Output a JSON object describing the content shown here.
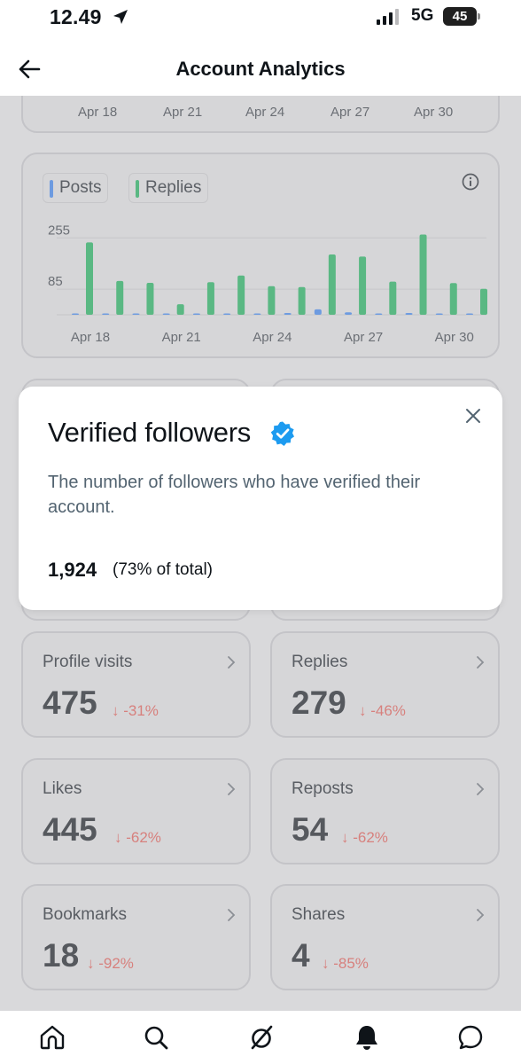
{
  "status": {
    "time": "12.49",
    "network": "5G",
    "battery": "45"
  },
  "header": {
    "title": "Account Analytics"
  },
  "top_card": {
    "dates": [
      "Apr 18",
      "Apr 21",
      "Apr 24",
      "Apr 27",
      "Apr 30"
    ]
  },
  "chart_data": {
    "type": "bar",
    "legend": [
      "Posts",
      "Replies"
    ],
    "y_ticks": [
      "255",
      "85"
    ],
    "x_ticks": [
      "Apr 18",
      "Apr 21",
      "Apr 24",
      "Apr 27",
      "Apr 30"
    ],
    "ylim": [
      0,
      300
    ],
    "categories": [
      "Apr 18",
      "Apr 19",
      "Apr 20",
      "Apr 21",
      "Apr 22",
      "Apr 23",
      "Apr 24",
      "Apr 25",
      "Apr 26",
      "Apr 27",
      "Apr 28",
      "Apr 29",
      "Apr 30",
      "May 1"
    ],
    "series": [
      {
        "name": "Posts",
        "color": "#6d9be0",
        "values": [
          1,
          1,
          0,
          1,
          1,
          0,
          0,
          6,
          18,
          8,
          1,
          6,
          1,
          1
        ]
      },
      {
        "name": "Replies",
        "color": "#5ab883",
        "values": [
          240,
          112,
          106,
          35,
          108,
          130,
          95,
          92,
          200,
          193,
          110,
          266,
          105,
          86
        ]
      }
    ]
  },
  "modal": {
    "title": "Verified followers",
    "description": "The number of followers who have verified their account.",
    "value": "1,924",
    "percent_text": "(73% of total)"
  },
  "metrics": [
    {
      "label": "Profile visits",
      "value": "475",
      "delta": "-31%"
    },
    {
      "label": "Replies",
      "value": "279",
      "delta": "-46%"
    },
    {
      "label": "Likes",
      "value": "445",
      "delta": "-62%"
    },
    {
      "label": "Reposts",
      "value": "54",
      "delta": "-62%"
    },
    {
      "label": "Bookmarks",
      "value": "18",
      "delta": "-92%"
    },
    {
      "label": "Shares",
      "value": "4",
      "delta": "-85%"
    }
  ],
  "icons": {
    "location": "location-arrow-icon",
    "back": "arrow-left-icon",
    "info": "info-icon",
    "verified": "verified-badge-icon",
    "close": "close-icon",
    "tabs": [
      "home-icon",
      "search-icon",
      "grok-icon",
      "notifications-bell-icon",
      "messages-icon"
    ]
  },
  "colors": {
    "verified": "#1d9bf0",
    "delta_down": "#d7807d"
  }
}
